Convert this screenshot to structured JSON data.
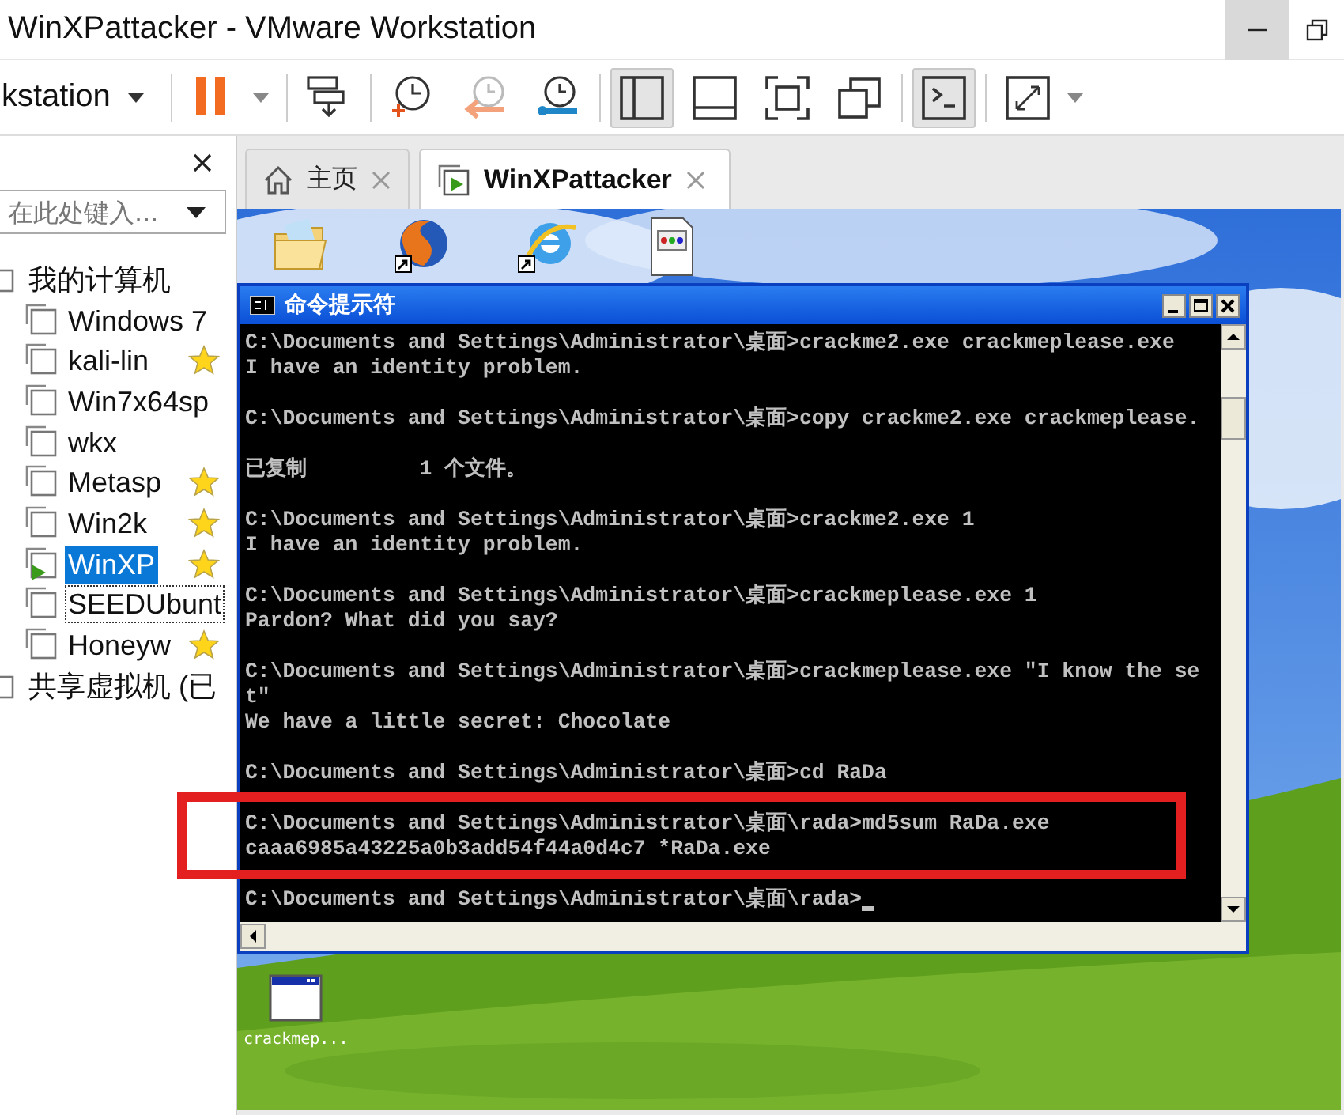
{
  "window": {
    "title": "WinXPattacker - VMware Workstation"
  },
  "toolbar": {
    "menu_label": "kstation",
    "groups": [
      [
        {
          "kind": "pause",
          "pressed": false,
          "has_menu": true
        }
      ],
      [
        {
          "kind": "send-keys",
          "pressed": false,
          "has_menu": false
        }
      ],
      [
        {
          "kind": "snapshot-take",
          "pressed": false,
          "has_menu": false
        },
        {
          "kind": "snapshot-revert",
          "pressed": false,
          "has_menu": false
        },
        {
          "kind": "snapshot-manager",
          "pressed": false,
          "has_menu": false
        }
      ],
      [
        {
          "kind": "library",
          "pressed": true,
          "has_menu": false
        },
        {
          "kind": "console-view",
          "pressed": false,
          "has_menu": false
        },
        {
          "kind": "full-screen",
          "pressed": false,
          "has_menu": false
        },
        {
          "kind": "unity",
          "pressed": false,
          "has_menu": false
        }
      ],
      [
        {
          "kind": "terminal",
          "pressed": true,
          "has_menu": false
        }
      ],
      [
        {
          "kind": "stretch",
          "pressed": false,
          "has_menu": true
        }
      ]
    ]
  },
  "sidebar": {
    "search": {
      "placeholder": "在此处键入..."
    },
    "tree": [
      {
        "label": "我的计算机",
        "children": [
          {
            "label": "Windows 7",
            "favorite": false,
            "running": false,
            "selected": false,
            "focused": false
          },
          {
            "label": "kali-lin",
            "favorite": true,
            "running": false,
            "selected": false,
            "focused": false
          },
          {
            "label": "Win7x64sp",
            "favorite": false,
            "running": false,
            "selected": false,
            "focused": false
          },
          {
            "label": "wkx",
            "favorite": false,
            "running": false,
            "selected": false,
            "focused": false
          },
          {
            "label": "Metasp",
            "favorite": true,
            "running": false,
            "selected": false,
            "focused": false
          },
          {
            "label": "Win2k",
            "favorite": true,
            "running": false,
            "selected": false,
            "focused": false
          },
          {
            "label": "WinXP",
            "favorite": true,
            "running": true,
            "selected": true,
            "focused": false
          },
          {
            "label": "SEEDUbunt",
            "favorite": false,
            "running": false,
            "selected": false,
            "focused": true
          },
          {
            "label": "Honeyw",
            "favorite": true,
            "running": false,
            "selected": false,
            "focused": false
          }
        ]
      },
      {
        "label": "共享虚拟机 (已"
      }
    ]
  },
  "tabs": [
    {
      "label": "主页",
      "kind": "home",
      "selected": false
    },
    {
      "label": "WinXPattacker",
      "kind": "vm",
      "selected": true
    }
  ],
  "vm_screen": {
    "desktop_icons": [
      {
        "kind": "folder"
      },
      {
        "kind": "fox-globe"
      },
      {
        "kind": "e-globe"
      },
      {
        "kind": "document"
      }
    ],
    "bottom_icon": {
      "kind": "window",
      "label": "crackmep..."
    },
    "console": {
      "title": "命令提示符",
      "cursor": true,
      "blocks": [
        [
          "C:\\Documents and Settings\\Administrator\\桌面>crackme2.exe crackmeplease.exe",
          "I have an identity problem."
        ],
        [
          "C:\\Documents and Settings\\Administrator\\桌面>copy crackme2.exe crackmeplease."
        ],
        [
          "已复制         1 个文件。"
        ],
        [
          "C:\\Documents and Settings\\Administrator\\桌面>crackme2.exe 1",
          "I have an identity problem."
        ],
        [
          "C:\\Documents and Settings\\Administrator\\桌面>crackmeplease.exe 1",
          "Pardon? What did you say?"
        ],
        [
          "C:\\Documents and Settings\\Administrator\\桌面>crackmeplease.exe \"I know the se",
          "t\"",
          "We have a little secret: Chocolate"
        ],
        [
          "C:\\Documents and Settings\\Administrator\\桌面>cd RaDa"
        ],
        [
          "C:\\Documents and Settings\\Administrator\\桌面\\rada>md5sum RaDa.exe",
          "caaa6985a43225a0b3add54f44a0d4c7 *RaDa.exe"
        ],
        [
          "C:\\Documents and Settings\\Administrator\\桌面\\rada>"
        ]
      ]
    }
  }
}
